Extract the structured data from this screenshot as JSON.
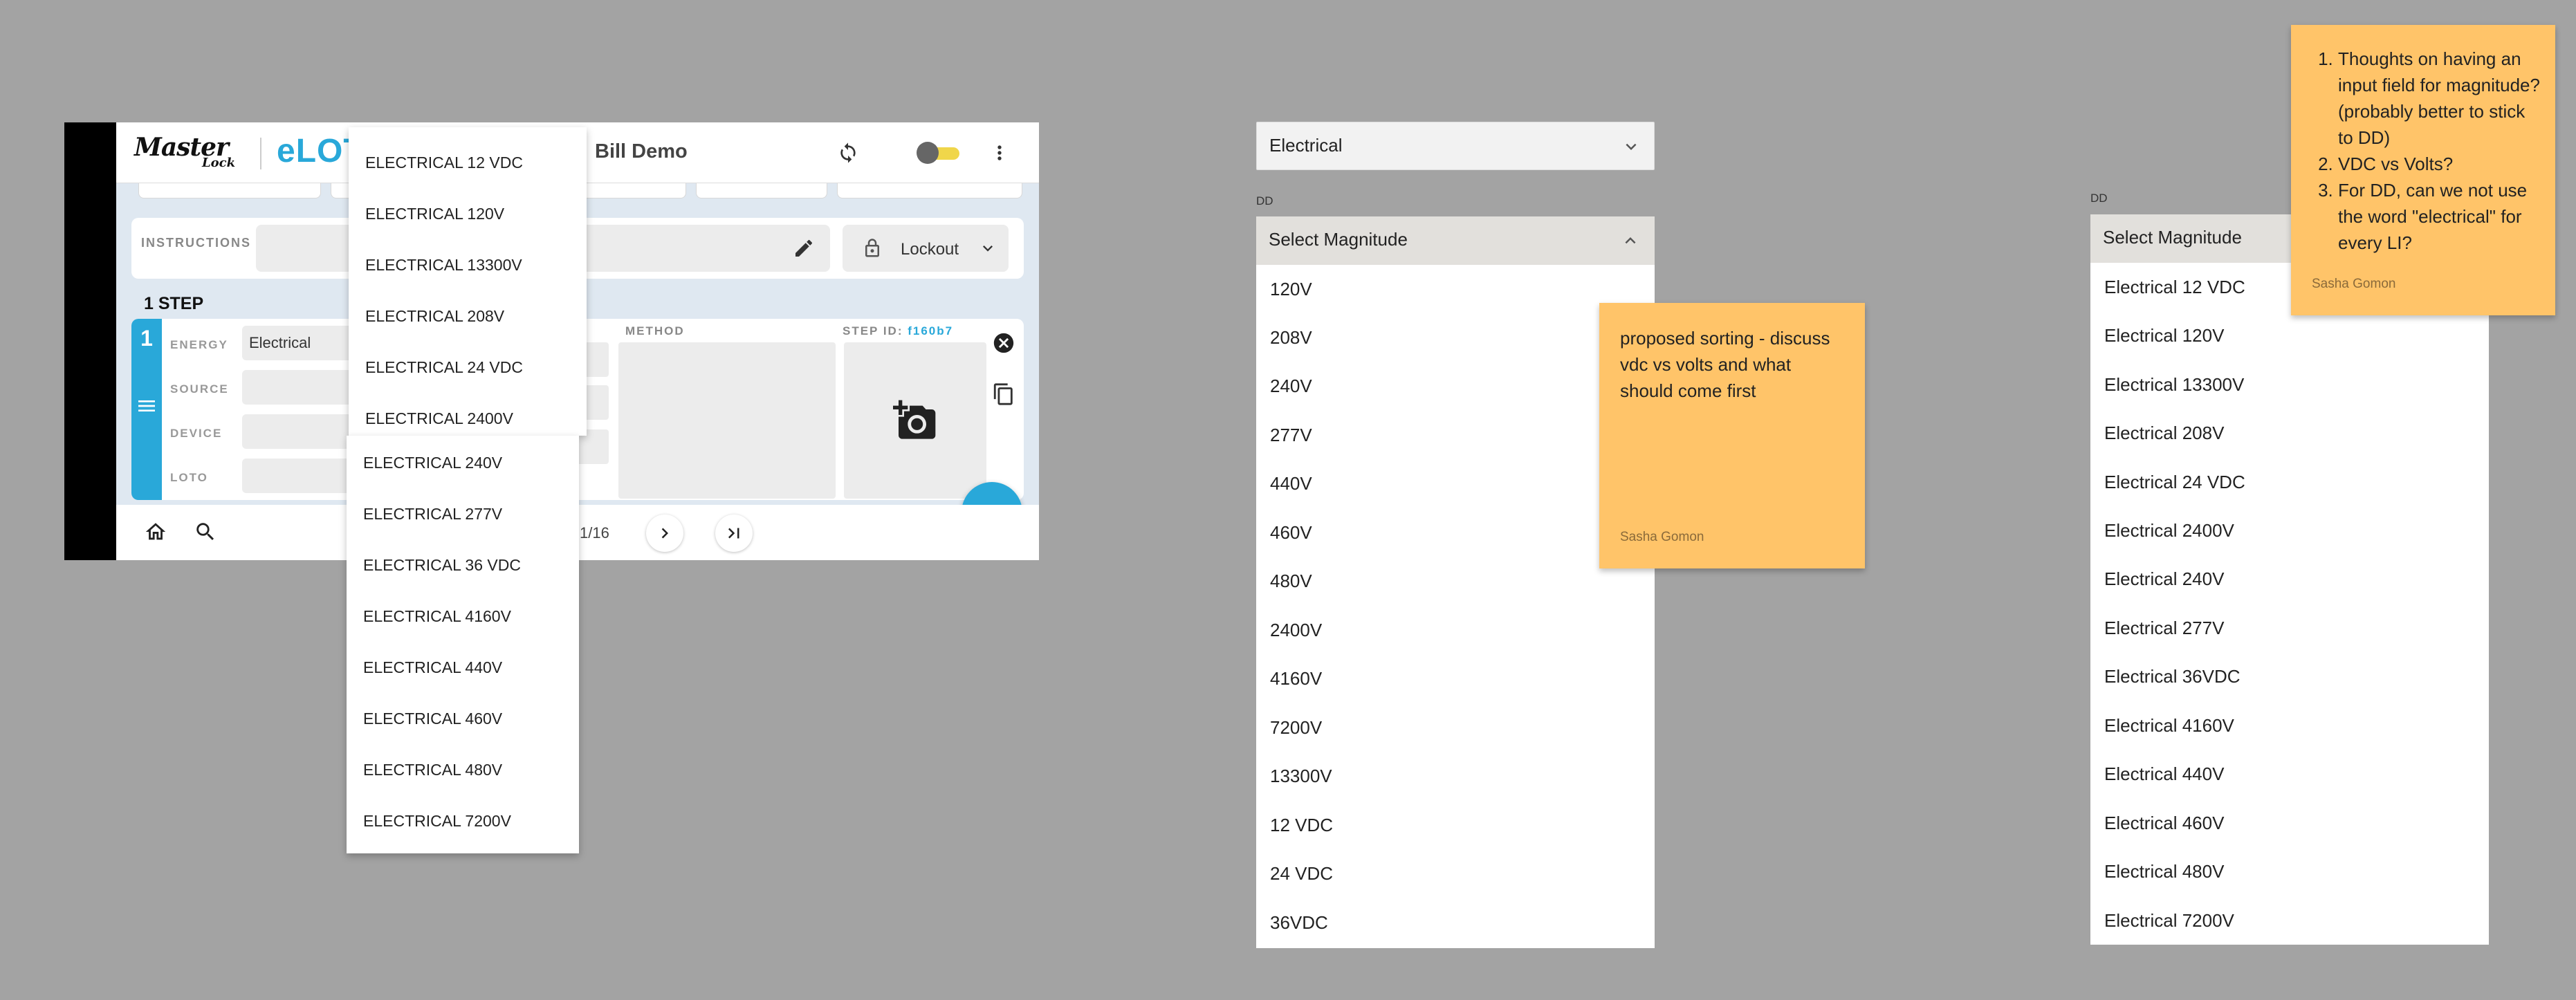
{
  "app": {
    "brand_name": "Master",
    "brand_sub": "Lock",
    "app_name": "eLOTO",
    "user": "Bill Demo",
    "instructions_label": "INSTRUCTIONS",
    "lockout_label": "Lockout",
    "step_count": "1 STEP",
    "step_number": "1",
    "fields": {
      "energy_label": "ENERGY",
      "energy_value": "Electrical",
      "source_label": "SOURCE",
      "device_label": "DEVICE",
      "loto_label": "LOTO"
    },
    "method_label": "METHOD",
    "step_id_label": "STEP ID:",
    "step_id_value": "f160b7",
    "page_text": "1/16"
  },
  "dropdown_menu": {
    "items_top": [
      "ELECTRICAL 12 VDC",
      "ELECTRICAL 120V",
      "ELECTRICAL 13300V",
      "ELECTRICAL 208V",
      "ELECTRICAL 24 VDC",
      "ELECTRICAL 2400V"
    ],
    "items_bottom": [
      "ELECTRICAL 240V",
      "ELECTRICAL 277V",
      "ELECTRICAL 36 VDC",
      "ELECTRICAL 4160V",
      "ELECTRICAL 440V",
      "ELECTRICAL 460V",
      "ELECTRICAL 480V",
      "ELECTRICAL 7200V"
    ]
  },
  "middle_panel": {
    "energy_select_value": "Electrical",
    "dd_tag": "DD",
    "magnitude_placeholder": "Select Magnitude",
    "options": [
      "120V",
      "208V",
      "240V",
      "277V",
      "440V",
      "460V",
      "480V",
      "2400V",
      "4160V",
      "7200V",
      "13300V",
      "12 VDC",
      "24 VDC",
      "36VDC"
    ]
  },
  "right_panel": {
    "dd_tag": "DD",
    "magnitude_placeholder": "Select Magnitude",
    "options": [
      "Electrical 12 VDC",
      "Electrical 120V",
      "Electrical 13300V",
      "Electrical 208V",
      "Electrical 24 VDC",
      "Electrical 2400V",
      "Electrical 240V",
      "Electrical 277V",
      "Electrical 36VDC",
      "Electrical 4160V",
      "Electrical 440V",
      "Electrical 460V",
      "Electrical 480V",
      "Electrical 7200V"
    ]
  },
  "notes": {
    "sorting": {
      "text": "proposed sorting - discuss vdc vs volts and what should come first",
      "author": "Sasha Gomon"
    },
    "questions": {
      "items": [
        "Thoughts on having an input field for magnitude? (probably better to stick to DD)",
        "VDC vs Volts?",
        "For DD, can we not use the word \"electrical\" for every LI?"
      ],
      "author": "Sasha Gomon"
    }
  },
  "colors": {
    "accent": "#29a8d9",
    "canvas": "#a3a3a3",
    "sticky": "#ffc469"
  },
  "icons": [
    "sync-icon",
    "toggle-switch",
    "more-vert-icon",
    "edit-icon",
    "lock-icon",
    "chevron-down-icon",
    "close-circle-icon",
    "copy-icon",
    "menu-icon",
    "add-photo-icon",
    "add-icon",
    "home-icon",
    "search-icon",
    "chevron-right-icon",
    "last-page-icon",
    "chevron-up-icon"
  ]
}
